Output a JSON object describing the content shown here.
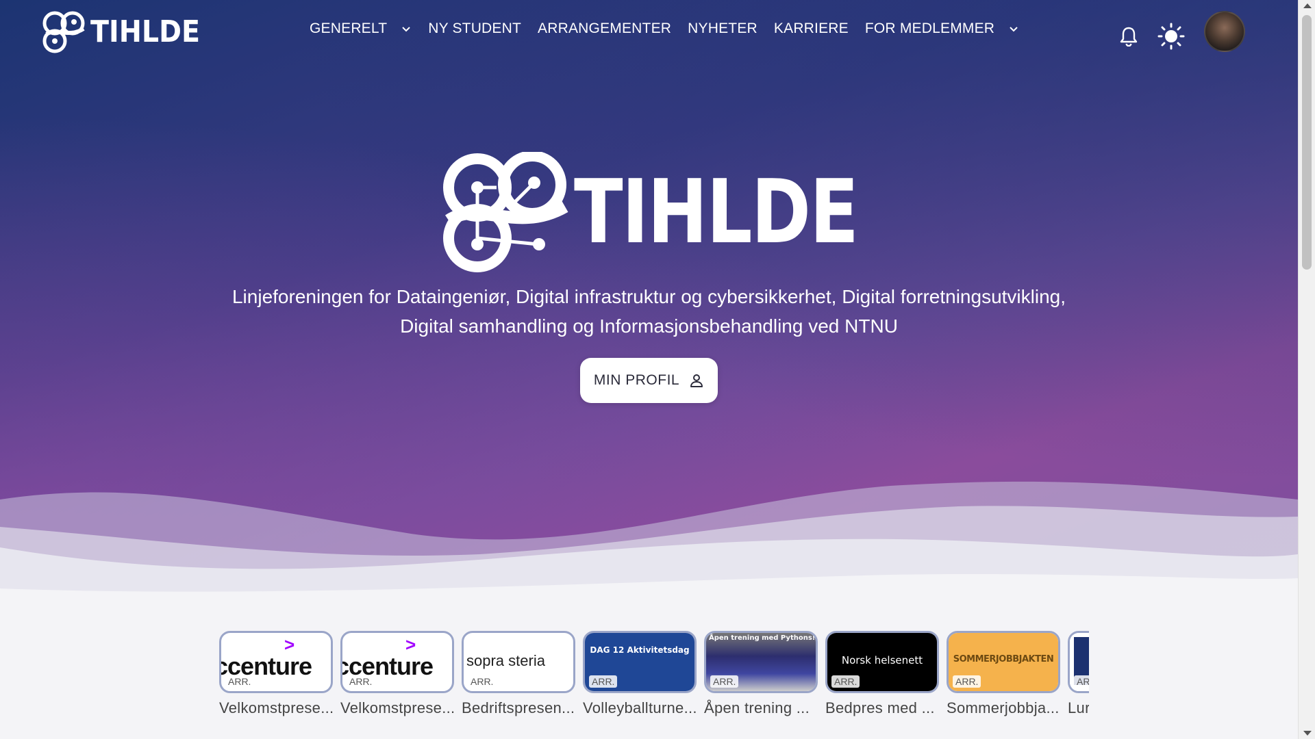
{
  "brand": {
    "name": "TIHLDE"
  },
  "nav": {
    "items": [
      {
        "label": "GENERELT",
        "has_dropdown": true
      },
      {
        "label": "NY STUDENT",
        "has_dropdown": false
      },
      {
        "label": "ARRANGEMENTER",
        "has_dropdown": false
      },
      {
        "label": "NYHETER",
        "has_dropdown": false
      },
      {
        "label": "KARRIERE",
        "has_dropdown": false
      },
      {
        "label": "FOR MEDLEMMER",
        "has_dropdown": true
      }
    ],
    "icons": [
      "bell-icon",
      "sun-icon",
      "avatar"
    ]
  },
  "hero": {
    "logo_text": "TIHLDE",
    "tagline_line1": "Linjeforeningen for Dataingeniør, Digital infrastruktur og cybersikkerhet, Digital forretningsutvikling,",
    "tagline_line2": "Digital samhandling og Informasjonsbehandling ved NTNU",
    "profile_button": "MIN PROFIL"
  },
  "events": {
    "badge": "ARR.",
    "cards": [
      {
        "title": "Velkomstprese...",
        "thumb_text": "ccenture"
      },
      {
        "title": "Velkomstprese...",
        "thumb_text": "ccenture"
      },
      {
        "title": "Bedriftspresen...",
        "thumb_text": "sopra steria"
      },
      {
        "title": "Volleyballturne...",
        "thumb_text": "DAG 12 Aktivitetsdag"
      },
      {
        "title": "Åpen trening ...",
        "thumb_text": "Åpen trening med Pythons!"
      },
      {
        "title": "Bedpres med ...",
        "thumb_text": "Norsk helsenett"
      },
      {
        "title": "Sommerjobbja...",
        "thumb_text": "SOMMERJOBBJAKTEN"
      },
      {
        "title": "Lur",
        "thumb_text": ""
      }
    ]
  },
  "colors": {
    "hero_top": "#1c3472",
    "hero_bottom": "#8a4c9c",
    "card_border": "#9aa5c8",
    "accenture_purple": "#a100ff",
    "sopra_red": "#e3001b"
  }
}
